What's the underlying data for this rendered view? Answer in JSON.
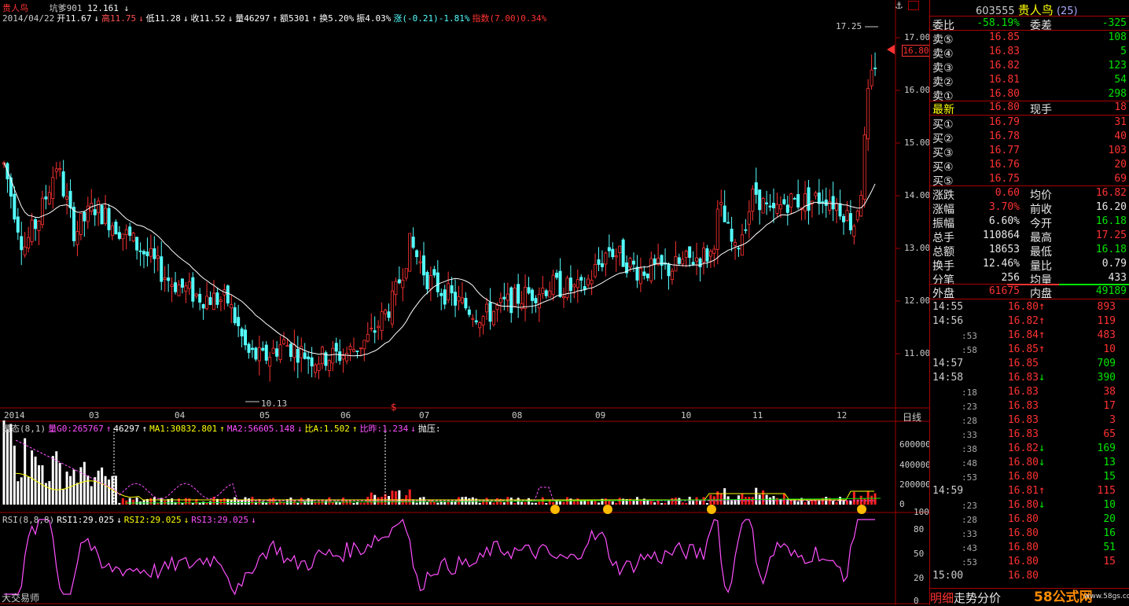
{
  "header": {
    "stock_name": "贵人鸟",
    "indicator_label": "坑爹901",
    "indicator_value": "12.161",
    "indicator_arrow": "↓",
    "ohlc": [
      {
        "text": "2014/04/22",
        "color": "#cccccc"
      },
      {
        "text": "开11.67",
        "color": "#ffffff"
      },
      {
        "text": "↓",
        "color": "#ffffff"
      },
      {
        "text": "高11.75",
        "color": "#ff5050"
      },
      {
        "text": "↓",
        "color": "#ff5050"
      },
      {
        "text": "低11.28",
        "color": "#ffffff"
      },
      {
        "text": "↓",
        "color": "#ffffff"
      },
      {
        "text": "收11.52",
        "color": "#ffffff"
      },
      {
        "text": "↓",
        "color": "#ffffff"
      },
      {
        "text": "量46297",
        "color": "#ffffff"
      },
      {
        "text": "↑",
        "color": "#ffffff"
      },
      {
        "text": "额5301",
        "color": "#ffffff"
      },
      {
        "text": "↑",
        "color": "#ffffff"
      },
      {
        "text": "换5.20%",
        "color": "#ffffff"
      },
      {
        "text": "振4.03%",
        "color": "#ffffff"
      },
      {
        "text": "涨(-0.21)-1.81%",
        "color": "#54ffff"
      },
      {
        "text": "指数(7.00)0.34%",
        "color": "#ff3232"
      }
    ]
  },
  "price_axis": {
    "ticks": [
      "17.00",
      "16.00",
      "15.00",
      "14.00",
      "13.00",
      "12.00",
      "11.00"
    ],
    "current_price": "16.80",
    "high_label": "17.25",
    "low_label": "10.13"
  },
  "time_axis": {
    "labels": [
      "2014",
      "03",
      "04",
      "05",
      "06",
      "07",
      "08",
      "09",
      "10",
      "11",
      "12"
    ],
    "period": "日线"
  },
  "volume_panel": {
    "items": [
      {
        "text": "量态(8,1)",
        "color": "#cccccc"
      },
      {
        "text": "量G0:265767",
        "color": "#ff50ff"
      },
      {
        "text": "↑",
        "color": "#ff50ff"
      },
      {
        "text": "46297",
        "color": "#ffffff"
      },
      {
        "text": "↑",
        "color": "#ffffff"
      },
      {
        "text": "MA1:30832.801",
        "color": "#ffff00"
      },
      {
        "text": "↑",
        "color": "#ffff00"
      },
      {
        "text": "MA2:56605.148",
        "color": "#ff50ff"
      },
      {
        "text": "↓",
        "color": "#ff50ff"
      },
      {
        "text": "比A:1.502",
        "color": "#ffff00"
      },
      {
        "text": "↑",
        "color": "#ffff00"
      },
      {
        "text": "比昨:1.234",
        "color": "#ff50ff"
      },
      {
        "text": "↓",
        "color": "#ff50ff"
      },
      {
        "text": "抛压:",
        "color": "#ffffff"
      }
    ],
    "ticks": [
      "600000",
      "400000",
      "200000",
      "0"
    ]
  },
  "rsi_panel": {
    "items": [
      {
        "text": "RSI(8,8,8)",
        "color": "#cccccc"
      },
      {
        "text": "RSI1:29.025",
        "color": "#ffffff"
      },
      {
        "text": "↓",
        "color": "#ffffff"
      },
      {
        "text": "RSI2:29.025",
        "color": "#ffff00"
      },
      {
        "text": "↓",
        "color": "#ffff00"
      },
      {
        "text": "RSI3:29.025",
        "color": "#ff50ff"
      },
      {
        "text": "↓",
        "color": "#ff50ff"
      }
    ],
    "ticks": [
      "100",
      "80",
      "50",
      "20",
      "0"
    ]
  },
  "footer": {
    "left": "大交易师",
    "tabs": [
      "明细",
      "走势",
      "分价"
    ],
    "watermark": "58公式网",
    "watermark_url": "www.58gs.com"
  },
  "quote": {
    "code": "603555",
    "name": "贵人鸟",
    "extra": "(25)",
    "weibi_label": "委比",
    "weibi_value": "-58.19%",
    "weicha_label": "委差",
    "weicha_value": "-325",
    "asks": [
      {
        "label": "卖⑤",
        "price": "16.85",
        "vol": "108"
      },
      {
        "label": "卖④",
        "price": "16.83",
        "vol": "5"
      },
      {
        "label": "卖③",
        "price": "16.82",
        "vol": "123"
      },
      {
        "label": "卖②",
        "price": "16.81",
        "vol": "54"
      },
      {
        "label": "卖①",
        "price": "16.80",
        "vol": "298"
      }
    ],
    "latest_label": "最新",
    "latest_price": "16.80",
    "xianshou_label": "现手",
    "xianshou_value": "18",
    "bids": [
      {
        "label": "买①",
        "price": "16.79",
        "vol": "31"
      },
      {
        "label": "买②",
        "price": "16.78",
        "vol": "40"
      },
      {
        "label": "买③",
        "price": "16.77",
        "vol": "103"
      },
      {
        "label": "买④",
        "price": "16.76",
        "vol": "20"
      },
      {
        "label": "买⑤",
        "price": "16.75",
        "vol": "69"
      }
    ],
    "stats": [
      {
        "l1": "涨跌",
        "v1": "0.60",
        "c1": "#ff3232",
        "l2": "均价",
        "v2": "16.82",
        "c2": "#ff3232"
      },
      {
        "l1": "涨幅",
        "v1": "3.70%",
        "c1": "#ff3232",
        "l2": "前收",
        "v2": "16.20",
        "c2": "#e8e8e8"
      },
      {
        "l1": "振幅",
        "v1": "6.60%",
        "c1": "#e8e8e8",
        "l2": "今开",
        "v2": "16.18",
        "c2": "#00e600"
      },
      {
        "l1": "总手",
        "v1": "110864",
        "c1": "#e8e8e8",
        "l2": "最高",
        "v2": "17.25",
        "c2": "#ff3232"
      },
      {
        "l1": "总额",
        "v1": "18653",
        "c1": "#e8e8e8",
        "l2": "最低",
        "v2": "16.18",
        "c2": "#00e600"
      },
      {
        "l1": "换手",
        "v1": "12.46%",
        "c1": "#e8e8e8",
        "l2": "量比",
        "v2": "0.79",
        "c2": "#e8e8e8"
      },
      {
        "l1": "分笔",
        "v1": "256",
        "c1": "#e8e8e8",
        "l2": "均量",
        "v2": "433",
        "c2": "#e8e8e8"
      }
    ],
    "waipan_label": "外盘",
    "waipan_value": "61675",
    "neipan_label": "内盘",
    "neipan_value": "49189"
  },
  "ticks_list": [
    {
      "time": "14:55",
      "sub": false,
      "price": "16.80",
      "pc": "#ff3232",
      "arrow": "↑",
      "ac": "#ff3232",
      "vol": "893",
      "vc": "#ff3232"
    },
    {
      "time": "14:56",
      "sub": false,
      "price": "16.82",
      "pc": "#ff3232",
      "arrow": "↑",
      "ac": "#ff3232",
      "vol": "119",
      "vc": "#ff3232"
    },
    {
      "time": ":53",
      "sub": true,
      "price": "16.84",
      "pc": "#ff3232",
      "arrow": "↑",
      "ac": "#ff3232",
      "vol": "483",
      "vc": "#ff3232"
    },
    {
      "time": ":58",
      "sub": true,
      "price": "16.85",
      "pc": "#ff3232",
      "arrow": "↑",
      "ac": "#ff3232",
      "vol": "10",
      "vc": "#ff3232"
    },
    {
      "time": "14:57",
      "sub": false,
      "price": "16.85",
      "pc": "#ff3232",
      "arrow": "",
      "ac": "#ff3232",
      "vol": "709",
      "vc": "#00e600"
    },
    {
      "time": "14:58",
      "sub": false,
      "price": "16.83",
      "pc": "#ff3232",
      "arrow": "↓",
      "ac": "#00e600",
      "vol": "390",
      "vc": "#00e600"
    },
    {
      "time": ":18",
      "sub": true,
      "price": "16.83",
      "pc": "#ff3232",
      "arrow": "",
      "ac": "#ff3232",
      "vol": "38",
      "vc": "#ff3232"
    },
    {
      "time": ":23",
      "sub": true,
      "price": "16.83",
      "pc": "#ff3232",
      "arrow": "",
      "ac": "#ff3232",
      "vol": "17",
      "vc": "#ff3232"
    },
    {
      "time": ":28",
      "sub": true,
      "price": "16.83",
      "pc": "#ff3232",
      "arrow": "",
      "ac": "#ff3232",
      "vol": "3",
      "vc": "#ff3232"
    },
    {
      "time": ":33",
      "sub": true,
      "price": "16.83",
      "pc": "#ff3232",
      "arrow": "",
      "ac": "#ff3232",
      "vol": "65",
      "vc": "#ff3232"
    },
    {
      "time": ":38",
      "sub": true,
      "price": "16.82",
      "pc": "#ff3232",
      "arrow": "↓",
      "ac": "#00e600",
      "vol": "169",
      "vc": "#00e600"
    },
    {
      "time": ":48",
      "sub": true,
      "price": "16.80",
      "pc": "#ff3232",
      "arrow": "↓",
      "ac": "#00e600",
      "vol": "13",
      "vc": "#00e600"
    },
    {
      "time": ":53",
      "sub": true,
      "price": "16.80",
      "pc": "#ff3232",
      "arrow": "",
      "ac": "#ff3232",
      "vol": "15",
      "vc": "#00e600"
    },
    {
      "time": "14:59",
      "sub": false,
      "price": "16.81",
      "pc": "#ff3232",
      "arrow": "↑",
      "ac": "#ff3232",
      "vol": "115",
      "vc": "#ff3232"
    },
    {
      "time": ":23",
      "sub": true,
      "price": "16.80",
      "pc": "#ff3232",
      "arrow": "↓",
      "ac": "#00e600",
      "vol": "10",
      "vc": "#00e600"
    },
    {
      "time": ":28",
      "sub": true,
      "price": "16.80",
      "pc": "#ff3232",
      "arrow": "",
      "ac": "#ff3232",
      "vol": "20",
      "vc": "#00e600"
    },
    {
      "time": ":33",
      "sub": true,
      "price": "16.80",
      "pc": "#ff3232",
      "arrow": "",
      "ac": "#ff3232",
      "vol": "16",
      "vc": "#00e600"
    },
    {
      "time": ":43",
      "sub": true,
      "price": "16.80",
      "pc": "#ff3232",
      "arrow": "",
      "ac": "#ff3232",
      "vol": "51",
      "vc": "#00e600"
    },
    {
      "time": ":53",
      "sub": true,
      "price": "16.80",
      "pc": "#ff3232",
      "arrow": "",
      "ac": "#ff3232",
      "vol": "15",
      "vc": "#ff3232"
    },
    {
      "time": "15:00",
      "sub": false,
      "price": "16.80",
      "pc": "#ff3232",
      "arrow": "",
      "ac": "#ff3232",
      "vol": "",
      "vc": "#ff3232"
    }
  ],
  "colors": {
    "up": "#ff3232",
    "down": "#54ffff",
    "ma": "#ffffff",
    "frame": "#a00000"
  },
  "icons": {
    "anchor": "anchor-icon",
    "window": "window-icon",
    "up_arrow": "up-arrow-icon",
    "down_arrow": "down-arrow-icon"
  }
}
